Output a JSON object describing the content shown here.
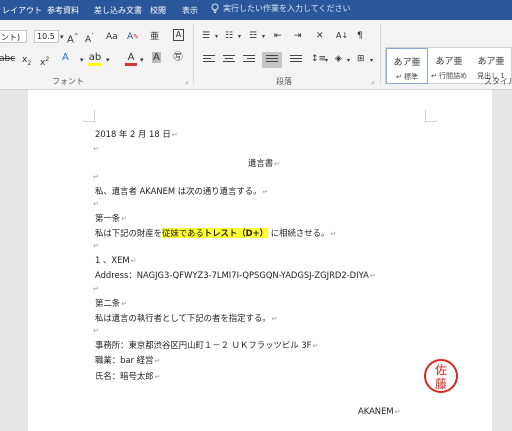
{
  "tabs": {
    "layout": "レイアウト",
    "references": "参考資料",
    "mailings": "差し込み文書",
    "review": "校閲",
    "view": "表示"
  },
  "tellme": "実行したい作業を入力してください",
  "font": {
    "name": "ント)",
    "size": "10.5",
    "group_label": "フォント"
  },
  "paragraph": {
    "group_label": "段落"
  },
  "styles": {
    "group_label": "スタイル",
    "items": [
      {
        "preview": "あア亜",
        "name": "↵ 標準"
      },
      {
        "preview": "あア亜",
        "name": "↵ 行間詰め"
      },
      {
        "preview": "あア亜",
        "name": "見出し 1"
      }
    ]
  },
  "colors": {
    "ribbon_blue": "#2b579a",
    "highlight": "#ffff33",
    "font_red": "#e03030",
    "seal_red": "#d42a20"
  },
  "doc": {
    "date": "2018 年 2 月 18 日",
    "title": "遺言書",
    "line_intro": "私、遺言者 AKANEM は次の通り遺言する。",
    "article1": "第一条",
    "line_art1_a": "私は下記の財産を",
    "line_art1_hl": "従妹である",
    "line_art1_bold": "トレスト（D+）",
    "line_art1_b": "に相続させる。",
    "xem": "1 、XEM",
    "address": "Address：NAGJG3-QFWYZ3-7LMI7I-QPSGQN-YADGSJ-ZGJRD2-DIYA",
    "article2": "第二条",
    "line_art2": "私は遺言の執行者として下記の者を指定する。",
    "office": "事務所：東京都渋谷区円山町１－２ ＵＫフラッツビル 3F",
    "job": "職業：bar 経営",
    "name": "氏名：暗号太郎",
    "signature": "AKANEM",
    "seal_chars": [
      "佐",
      "藤"
    ]
  }
}
